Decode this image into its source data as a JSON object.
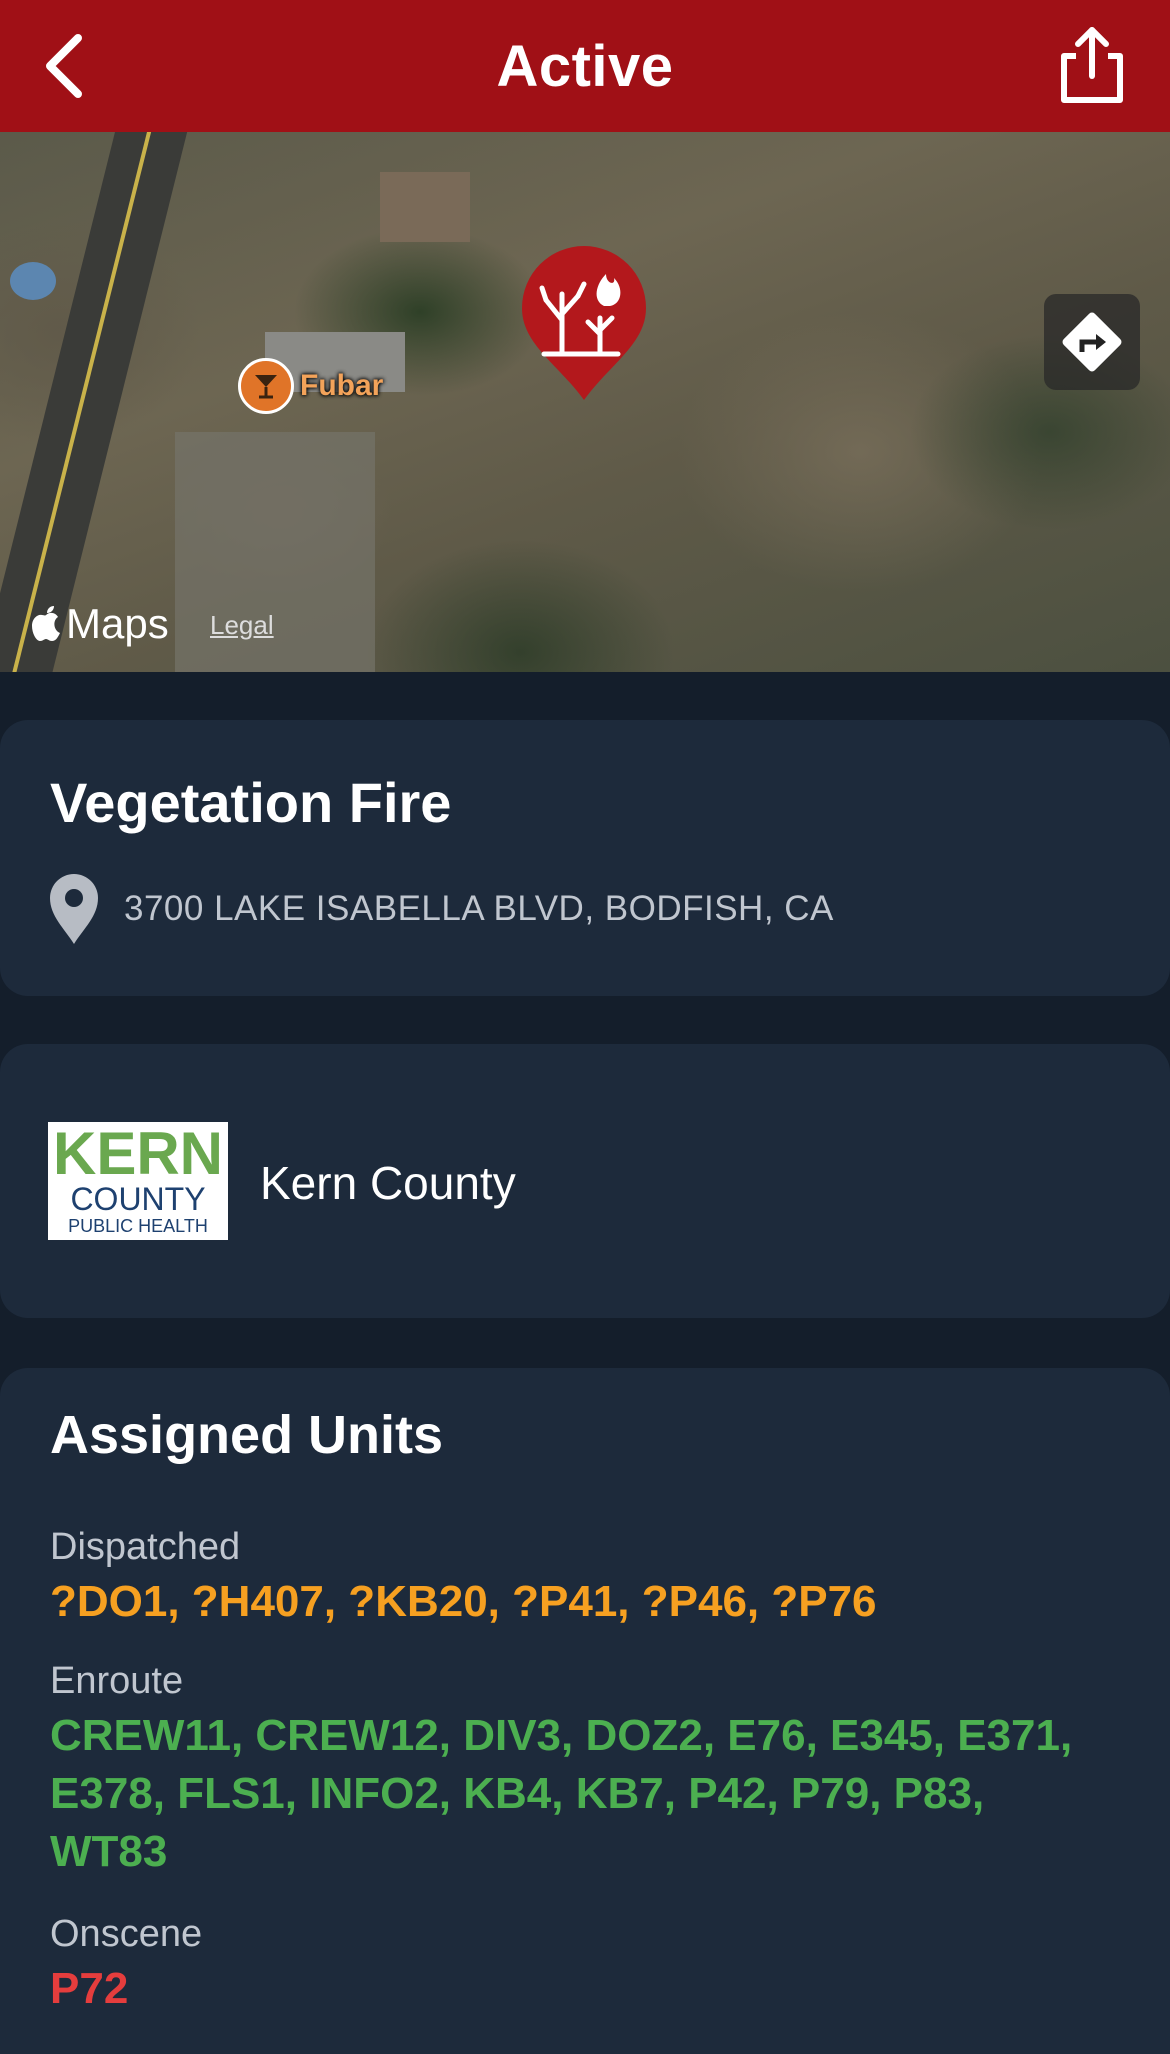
{
  "nav": {
    "title": "Active",
    "back_icon": "chevron-left-icon",
    "share_icon": "share-icon",
    "bar_color": "#a01016"
  },
  "map": {
    "poi_label": "Fubar",
    "poi_icon": "cocktail-glass-icon",
    "pin_icon": "vegetation-fire-icon",
    "directions_icon": "directions-icon",
    "brand": "Maps",
    "legal": "Legal"
  },
  "incident": {
    "title": "Vegetation Fire",
    "address": "3700 LAKE ISABELLA BLVD, BODFISH, CA",
    "location_icon": "location-pin-icon"
  },
  "agency": {
    "name": "Kern County",
    "logo_line1": "KERN",
    "logo_line2": "COUNTY",
    "logo_line3": "PUBLIC HEALTH"
  },
  "units": {
    "title": "Assigned Units",
    "dispatched_label": "Dispatched",
    "dispatched": "?DO1, ?H407, ?KB20, ?P41, ?P46, ?P76",
    "enroute_label": "Enroute",
    "enroute": "CREW11, CREW12, DIV3, DOZ2, E76, E345, E371, E378, FLS1, INFO2, KB4, KB7, P42, P79, P83, WT83",
    "onscene_label": "Onscene",
    "onscene": "P72",
    "colors": {
      "dispatched": "#f6a021",
      "enroute": "#4caf50",
      "onscene": "#e53d3d"
    }
  }
}
